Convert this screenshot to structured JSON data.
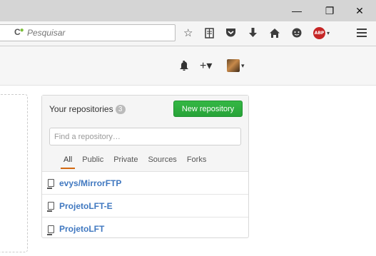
{
  "window": {
    "minimize_glyph": "—",
    "restore_glyph": "❐",
    "close_glyph": "✕"
  },
  "browser": {
    "search": {
      "engine_icon": "C",
      "placeholder": "Pesquisar",
      "value": ""
    },
    "toolbar_icons": [
      "bookmark-star-icon",
      "reading-list-icon",
      "pocket-icon",
      "download-icon",
      "home-icon",
      "chat-icon",
      "adblock-plus-icon",
      "menu-icon"
    ],
    "abp_label": "ABP"
  },
  "github_header": {
    "notifications_icon": "bell-icon",
    "create_label": "+▾",
    "avatar_caret": "▾"
  },
  "repositories": {
    "title": "Your repositories",
    "count": "3",
    "new_button": "New repository",
    "find_placeholder": "Find a repository…",
    "filters": [
      "All",
      "Public",
      "Private",
      "Sources",
      "Forks"
    ],
    "active_filter": "All",
    "items": [
      {
        "name": "evys/MirrorFTP"
      },
      {
        "name": "ProjetoLFT-E"
      },
      {
        "name": "ProjetoLFT"
      }
    ]
  },
  "colors": {
    "accent_green": "#2cbe4e",
    "link_blue": "#4078c0",
    "tab_underline": "#d26911"
  }
}
